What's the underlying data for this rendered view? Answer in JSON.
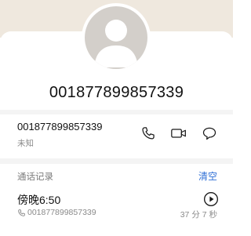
{
  "contact": {
    "name": "001877899857339",
    "number": "001877899857339",
    "number_label": "未知"
  },
  "actions": {
    "call_icon": "phone-icon",
    "video_icon": "video-call-icon",
    "message_icon": "message-bubble-icon"
  },
  "call_log": {
    "section_title": "通话记录",
    "clear_label": "清空",
    "records": [
      {
        "time": "傍晚6:50",
        "number": "001877899857339",
        "duration": "37 分 7 秒"
      }
    ]
  },
  "colors": {
    "header_bg": "#efe8de",
    "accent": "#2f6fd6",
    "avatar_bg": "#d3cfca"
  }
}
